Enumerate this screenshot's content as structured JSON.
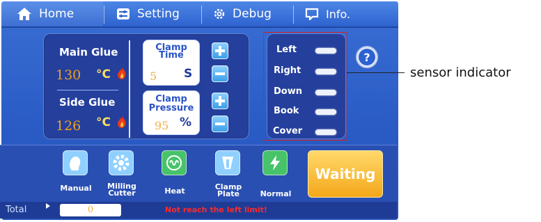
{
  "nav": {
    "items": [
      {
        "label": "Home",
        "icon": "home-icon"
      },
      {
        "label": "Setting",
        "icon": "settings-icon"
      },
      {
        "label": "Debug",
        "icon": "gear-icon"
      },
      {
        "label": "Info.",
        "icon": "info-icon"
      }
    ]
  },
  "glue": {
    "main_label": "Main Glue",
    "main_value": "130",
    "side_label": "Side Glue",
    "side_value": "126",
    "temp_unit": "°C"
  },
  "clamp": {
    "time_title_1": "Clamp",
    "time_title_2": "Time",
    "time_value": "5",
    "time_unit": "S",
    "pressure_title_1": "Clamp",
    "pressure_title_2": "Pressure",
    "pressure_value": "95",
    "pressure_unit": "%"
  },
  "sensors": {
    "items": [
      {
        "label": "Left"
      },
      {
        "label": "Right"
      },
      {
        "label": "Down"
      },
      {
        "label": "Book"
      },
      {
        "label": "Cover"
      }
    ]
  },
  "help": {
    "label": "?"
  },
  "tools": [
    {
      "label": "Manual",
      "icon": "hand-icon",
      "color": "#8fd0ff"
    },
    {
      "label_1": "Milling",
      "label_2": "Cutter",
      "icon": "gear-icon",
      "color": "#8fd0ff"
    },
    {
      "label": "Heat",
      "icon": "heat-icon",
      "color": "#47c36a"
    },
    {
      "label_1": "Clamp",
      "label_2": "Plate",
      "icon": "clamp-icon",
      "color": "#8fd0ff"
    },
    {
      "label": "Normal",
      "icon": "lightning-icon",
      "color": "#47c36a"
    }
  ],
  "waiting": {
    "label": "Waiting",
    "color": "#f4a81a"
  },
  "status": {
    "total_label": "Total",
    "total_value": "0",
    "message": "Not reach the left limit!",
    "message_color": "#ff2a2a"
  },
  "annotation": {
    "label": "sensor indicator"
  }
}
